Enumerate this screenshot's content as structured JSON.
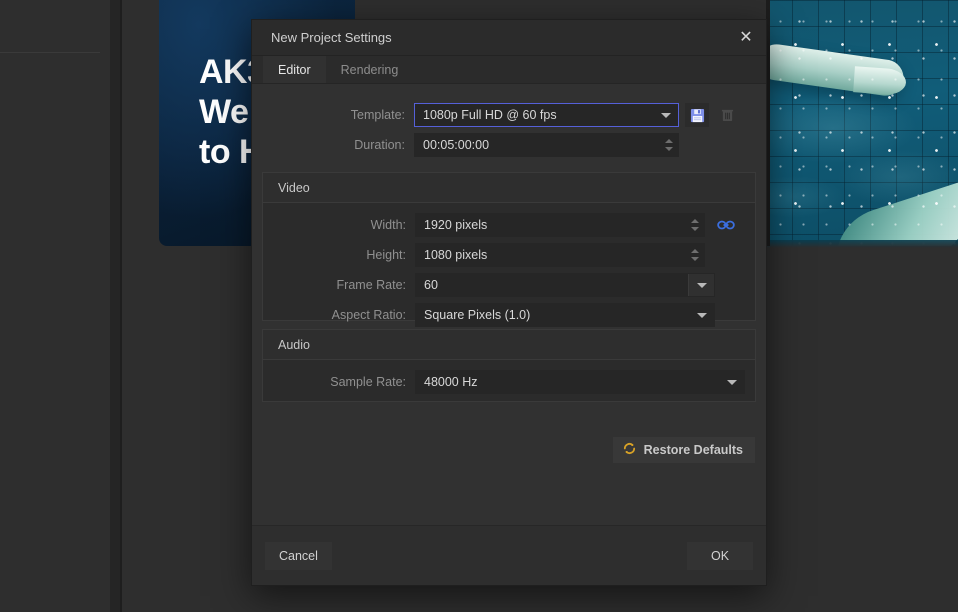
{
  "background": {
    "hero_lines": [
      "AK3",
      "We",
      "to H"
    ],
    "photo_alt": "underwater-swimmer-photo"
  },
  "dialog": {
    "title": "New Project Settings",
    "close_label": "✕",
    "tabs": [
      {
        "label": "Editor",
        "active": true
      },
      {
        "label": "Rendering",
        "active": false
      }
    ],
    "top": {
      "template_label": "Template:",
      "template_value": "1080p Full HD @ 60 fps",
      "save_icon": "floppy-disk-save-icon",
      "delete_icon": "trash-delete-icon",
      "duration_label": "Duration:",
      "duration_value": "00:05:00:00"
    },
    "video": {
      "group_title": "Video",
      "width_label": "Width:",
      "width_value": "1920 pixels",
      "height_label": "Height:",
      "height_value": "1080 pixels",
      "link_icon": "chain-link-icon",
      "framerate_label": "Frame Rate:",
      "framerate_value": "60",
      "aspect_label": "Aspect Ratio:",
      "aspect_value": "Square Pixels (1.0)"
    },
    "audio": {
      "group_title": "Audio",
      "samplerate_label": "Sample Rate:",
      "samplerate_value": "48000 Hz"
    },
    "restore": {
      "label": "Restore Defaults",
      "icon": "refresh-circular-arrows-icon"
    },
    "footer": {
      "cancel_label": "Cancel",
      "ok_label": "OK"
    }
  },
  "colors": {
    "dialog_bg": "#313131",
    "group_bg": "#2b2b2b",
    "field_bg": "#262626",
    "focus_border": "#5560d8",
    "link_blue": "#3b6fe0",
    "save_blue": "#7e8fe8",
    "restore_gold": "#d8a226",
    "text_primary": "#d8d8d8",
    "text_muted": "#909090"
  }
}
